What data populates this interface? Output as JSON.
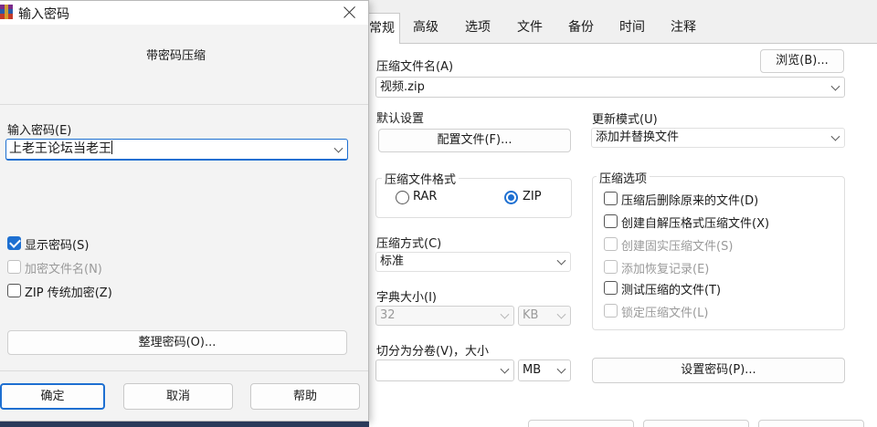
{
  "archive_dialog": {
    "tabs": [
      "常规",
      "高级",
      "选项",
      "文件",
      "备份",
      "时间",
      "注释"
    ],
    "archive_name_label": "压缩文件名(A)",
    "archive_name_value": "视频.zip",
    "browse_button": "浏览(B)...",
    "default_profile_label": "默认设置",
    "profiles_button": "配置文件(F)...",
    "update_mode_label": "更新模式(U)",
    "update_mode_value": "添加并替换文件",
    "format_group_title": "压缩文件格式",
    "format_rar": "RAR",
    "format_zip": "ZIP",
    "method_label": "压缩方式(C)",
    "method_value": "标准",
    "dict_label": "字典大小(I)",
    "dict_value": "32",
    "dict_unit": "KB",
    "split_label": "切分为分卷(V)，大小",
    "split_value": "",
    "split_unit": "MB",
    "set_password_button": "设置密码(P)...",
    "options_group_title": "压缩选项",
    "options": [
      {
        "label": "压缩后删除原来的文件(D)",
        "checked": false,
        "enabled": true
      },
      {
        "label": "创建自解压格式压缩文件(X)",
        "checked": false,
        "enabled": true
      },
      {
        "label": "创建固实压缩文件(S)",
        "checked": false,
        "enabled": false
      },
      {
        "label": "添加恢复记录(E)",
        "checked": false,
        "enabled": false
      },
      {
        "label": "测试压缩的文件(T)",
        "checked": false,
        "enabled": true
      },
      {
        "label": "锁定压缩文件(L)",
        "checked": false,
        "enabled": false
      }
    ]
  },
  "password_dialog": {
    "title": "输入密码",
    "subtitle": "带密码压缩",
    "password_label": "输入密码(E)",
    "password_value": "上老王论坛当老王",
    "show_password": "显示密码(S)",
    "encrypt_names": "加密文件名(N)",
    "zip_legacy": "ZIP 传统加密(Z)",
    "organize_button": "整理密码(O)...",
    "ok_button": "确定",
    "cancel_button": "取消",
    "help_button": "帮助"
  },
  "colors": {
    "accent": "#1d6fd1",
    "dialog_bg": "#f3f3f3",
    "panel_bg": "#ffffff"
  }
}
